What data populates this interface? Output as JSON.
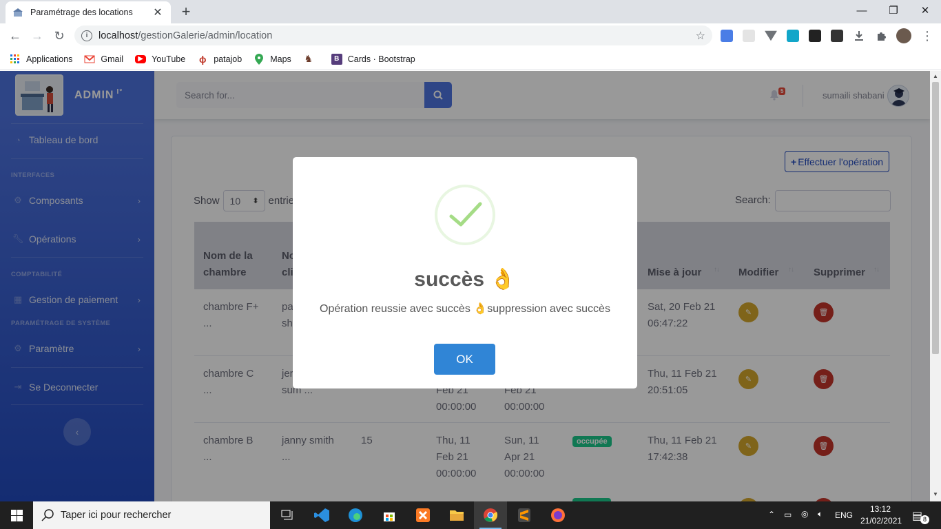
{
  "browser": {
    "tab_title": "Paramétrage des locations",
    "url_host": "localhost",
    "url_path": "/gestionGalerie/admin/location",
    "bookmarks": [
      {
        "label": "Applications",
        "icon": "apps-grid-icon"
      },
      {
        "label": "Gmail",
        "icon": "gmail-icon"
      },
      {
        "label": "YouTube",
        "icon": "youtube-icon"
      },
      {
        "label": "patajob",
        "icon": "patajob-icon"
      },
      {
        "label": "Maps",
        "icon": "maps-icon"
      },
      {
        "label": "",
        "icon": "bookmark-figure-icon"
      },
      {
        "label": "Cards · Bootstrap",
        "icon": "bootstrap-icon"
      }
    ]
  },
  "sidebar": {
    "brand": "ADMIN",
    "brand_sup": "I°",
    "dashboard": "Tableau de bord",
    "heading_interfaces": "INTERFACES",
    "components": "Composants",
    "operations": "Opérations",
    "heading_accounting": "COMPTABILITÉ",
    "payments": "Gestion de paiement",
    "heading_system": "PARAMÉTRAGE DE SYSTÈME",
    "settings": "Paramètre",
    "logout": "Se Deconnecter"
  },
  "topbar": {
    "search_placeholder": "Search for...",
    "notif_count": "5",
    "user_name": "sumaili shabani"
  },
  "content": {
    "op_button": "Effectuer l'opération",
    "show_label": "Show",
    "show_value": "10",
    "entries_label": "entrie",
    "search_label": "Search:",
    "columns": {
      "room": [
        "Nom de la",
        "chambre"
      ],
      "client": [
        "No",
        "cli"
      ],
      "updated": "Mise à jour",
      "edit": "Modifier",
      "delete": "Supprimer"
    },
    "rows": [
      {
        "room": [
          "chambre F+",
          "..."
        ],
        "client": [
          "pa",
          "sh"
        ],
        "updated": [
          "Sat, 20 Feb 21",
          "06:47:22"
        ]
      },
      {
        "room": [
          "chambre C",
          "..."
        ],
        "client": [
          "jer",
          "sum ..."
        ],
        "start_partial": [
          "Feb 21",
          "00:00:00"
        ],
        "end_partial": [
          "Feb 21",
          "00:00:00"
        ],
        "updated": [
          "Thu, 11 Feb 21",
          "20:51:05"
        ]
      },
      {
        "room": [
          "chambre B",
          "..."
        ],
        "client": [
          "janny smith",
          "..."
        ],
        "qty": "15",
        "start": [
          "Thu, 11",
          "Feb 21",
          "00:00:00"
        ],
        "end": [
          "Sun, 11",
          "Apr 21",
          "00:00:00"
        ],
        "status": "occupée",
        "updated": [
          "Thu, 11 Feb 21",
          "17:42:38"
        ]
      }
    ]
  },
  "modal": {
    "title": "succès 👌",
    "message": "Opération reussie avec succès 👌suppression avec succès",
    "ok": "OK"
  },
  "taskbar": {
    "search_placeholder": "Taper ici pour rechercher",
    "lang": "ENG",
    "time": "13:12",
    "date": "21/02/2021",
    "notif_count": "8"
  },
  "colors": {
    "primary": "#4e73df",
    "success": "#1cc88a",
    "warning": "#d4a72c",
    "danger": "#c4352b",
    "swal_confirm": "#3085d6"
  }
}
